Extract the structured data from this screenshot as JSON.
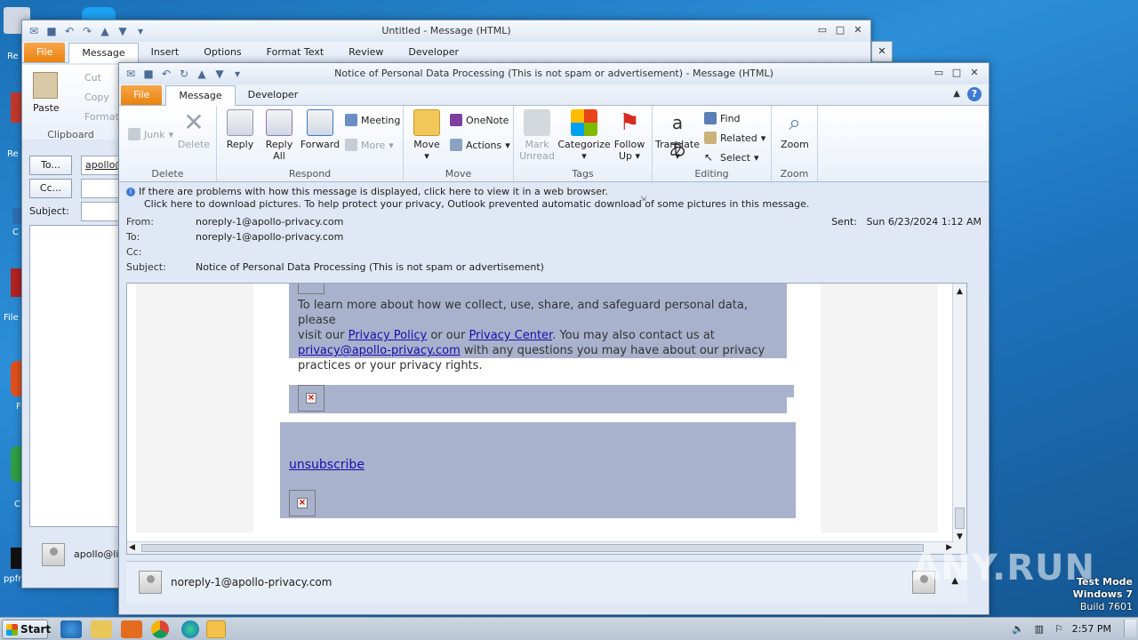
{
  "desktop": {
    "icons": [
      {
        "label": "Re"
      },
      {
        "label": "Re"
      },
      {
        "label": "C"
      },
      {
        "label": "File"
      },
      {
        "label": "F"
      },
      {
        "label": "C"
      },
      {
        "label": "ppfrenc"
      }
    ]
  },
  "back_window": {
    "title": "Untitled  -  Message (HTML)",
    "tabs": [
      "File",
      "Message",
      "Insert",
      "Options",
      "Format Text",
      "Review",
      "Developer"
    ],
    "active_tab": "Message",
    "clipboard": {
      "paste": "Paste",
      "cut": "Cut",
      "copy": "Copy",
      "format": "Format",
      "group": "Clipboard"
    },
    "to_button": "To...",
    "cc_button": "Cc...",
    "subject_label": "Subject:",
    "to_value": "apollo@",
    "people_name": "apollo@li"
  },
  "window": {
    "title": "Notice of Personal Data Processing (This is not spam or advertisement)  -  Message (HTML)",
    "tabs": [
      "File",
      "Message",
      "Developer"
    ],
    "active_tab": "Message",
    "ribbon": {
      "delete_group": {
        "label": "Delete",
        "junk": "Junk",
        "delete": "Delete"
      },
      "respond_group": {
        "label": "Respond",
        "reply": "Reply",
        "reply_all_1": "Reply",
        "reply_all_2": "All",
        "forward": "Forward",
        "meeting": "Meeting",
        "more": "More"
      },
      "move_group": {
        "label": "Move",
        "move": "Move",
        "onenote": "OneNote",
        "actions": "Actions"
      },
      "tags_group": {
        "label": "Tags",
        "mark_unread_1": "Mark",
        "mark_unread_2": "Unread",
        "categorize": "Categorize",
        "follow_up_1": "Follow",
        "follow_up_2": "Up"
      },
      "editing_group": {
        "label": "Editing",
        "translate": "Translate",
        "find": "Find",
        "related": "Related",
        "select": "Select"
      },
      "zoom_group": {
        "label": "Zoom",
        "zoom": "Zoom"
      }
    },
    "infobar": {
      "line1": "If there are problems with how this message is displayed, click here to view it in a web browser.",
      "line2": "Click here to download pictures. To help protect your privacy, Outlook prevented automatic download of some pictures in this message."
    },
    "header": {
      "from_label": "From:",
      "from": "noreply-1@apollo-privacy.com",
      "to_label": "To:",
      "to": "noreply-1@apollo-privacy.com",
      "cc_label": "Cc:",
      "cc": "",
      "subject_label": "Subject:",
      "subject": "Notice of Personal Data Processing (This is not spam or advertisement)",
      "sent_label": "Sent:",
      "sent": "Sun 6/23/2024 1:12 AM"
    },
    "body": {
      "para_1": "To learn more about how we collect, use, share, and safeguard personal data, please",
      "para_2a": "visit our ",
      "link_policy": "Privacy Policy",
      "para_2b": " or our ",
      "link_center": "Privacy Center",
      "para_2c": ". You may also contact us at",
      "link_email": "privacy@apollo-privacy.com",
      "para_3b": " with any questions you may have about our privacy",
      "para_4": "practices or your privacy rights.",
      "unsubscribe": "unsubscribe"
    },
    "people_pane": {
      "name": "noreply-1@apollo-privacy.com"
    }
  },
  "taskbar": {
    "start": "Start",
    "clock": "2:57 PM"
  },
  "watermark": {
    "testmode": "Test Mode",
    "os": "Windows 7",
    "build": "Build 7601",
    "brand": "ANY.RUN"
  }
}
